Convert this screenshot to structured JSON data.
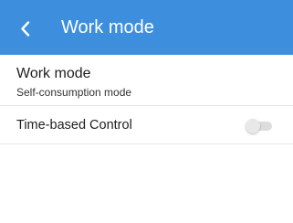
{
  "header": {
    "title": "Work mode",
    "back_icon": "chevron-left-icon",
    "background_color": "#3d8fde"
  },
  "work_mode": {
    "title": "Work mode",
    "value": "Self-consumption mode"
  },
  "time_based_control": {
    "label": "Time-based Control",
    "enabled": false
  }
}
